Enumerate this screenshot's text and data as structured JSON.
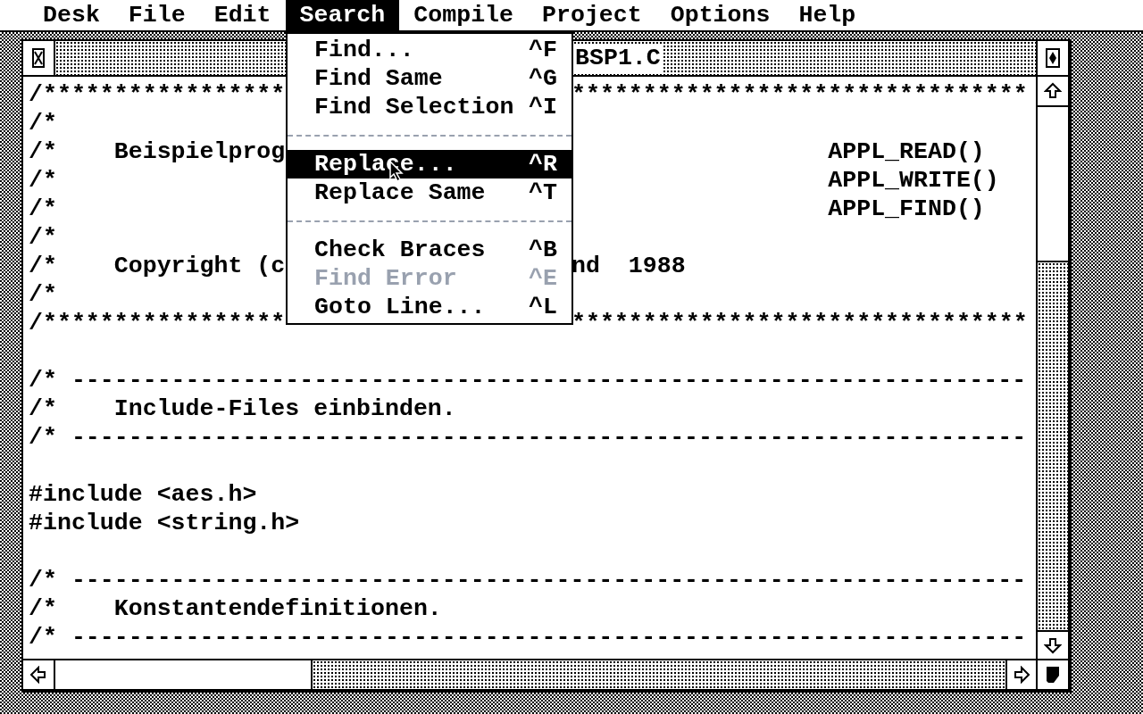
{
  "menu_bar": [
    {
      "label": "Desk",
      "selected": false
    },
    {
      "label": "File",
      "selected": false
    },
    {
      "label": "Edit",
      "selected": false
    },
    {
      "label": "Search",
      "selected": true
    },
    {
      "label": "Compile",
      "selected": false
    },
    {
      "label": "Project",
      "selected": false
    },
    {
      "label": "Options",
      "selected": false
    },
    {
      "label": "Help",
      "selected": false
    }
  ],
  "search_menu": [
    {
      "kind": "item",
      "label": "Find...",
      "shortcut": "^F",
      "selected": false,
      "disabled": false
    },
    {
      "kind": "item",
      "label": "Find Same",
      "shortcut": "^G",
      "selected": false,
      "disabled": false
    },
    {
      "kind": "item",
      "label": "Find Selection",
      "shortcut": "^I",
      "selected": false,
      "disabled": false
    },
    {
      "kind": "separator"
    },
    {
      "kind": "item",
      "label": "Replace...",
      "shortcut": "^R",
      "selected": true,
      "disabled": false
    },
    {
      "kind": "item",
      "label": "Replace Same",
      "shortcut": "^T",
      "selected": false,
      "disabled": false
    },
    {
      "kind": "separator"
    },
    {
      "kind": "item",
      "label": "Check Braces",
      "shortcut": "^B",
      "selected": false,
      "disabled": false
    },
    {
      "kind": "item",
      "label": "Find Error",
      "shortcut": "^E",
      "selected": false,
      "disabled": true
    },
    {
      "kind": "item",
      "label": "Goto Line...",
      "shortcut": "^L",
      "selected": false,
      "disabled": false
    }
  ],
  "window": {
    "title": "BSP1.C"
  },
  "code_lines": [
    {
      "kind": "code",
      "text": "/*****************",
      "tail": "********************************"
    },
    {
      "kind": "code",
      "text": "/*"
    },
    {
      "kind": "code",
      "text": "/*    Beispielprog",
      "tail": "                  APPL_READ()"
    },
    {
      "kind": "code",
      "text": "/*",
      "tail": "                  APPL_WRITE()"
    },
    {
      "kind": "code",
      "text": "/*",
      "tail": "                  APPL_FIND()"
    },
    {
      "kind": "code",
      "text": "/*"
    },
    {
      "kind": "code",
      "text": "/*    Copyright (c",
      "tail": "nd  1988"
    },
    {
      "kind": "code",
      "text": "/*"
    },
    {
      "kind": "code",
      "text": "/*****************",
      "tail": "********************************"
    },
    {
      "kind": "blank"
    },
    {
      "kind": "code",
      "text": "/* -------------------------------------------------------------------"
    },
    {
      "kind": "code",
      "text": "/*    Include-Files einbinden."
    },
    {
      "kind": "code",
      "text": "/* -------------------------------------------------------------------"
    },
    {
      "kind": "blank"
    },
    {
      "kind": "code",
      "text": "#include <aes.h>"
    },
    {
      "kind": "code",
      "text": "#include <string.h>"
    },
    {
      "kind": "blank"
    },
    {
      "kind": "code",
      "text": "/* -------------------------------------------------------------------"
    },
    {
      "kind": "code",
      "text": "/*    Konstantendefinitionen."
    },
    {
      "kind": "code",
      "text": "/* -------------------------------------------------------------------"
    }
  ]
}
